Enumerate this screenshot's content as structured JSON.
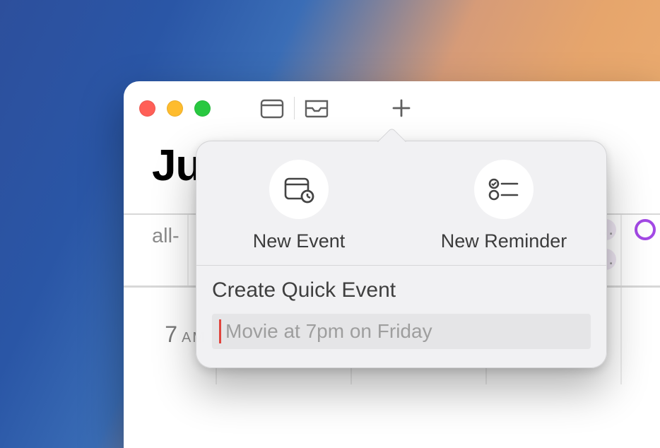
{
  "toolbar": {
    "icons": {
      "calendar": "calendar-icon",
      "inbox": "tray-icon",
      "add": "plus-icon"
    }
  },
  "header": {
    "month_abbrev": "Ju"
  },
  "calendar": {
    "allday_label": "all-",
    "hour": {
      "value": "7",
      "period": "AM"
    },
    "chips": {
      "more1": "…",
      "more2": "…"
    }
  },
  "popover": {
    "option1": {
      "label": "New Event"
    },
    "option2": {
      "label": "New Reminder"
    },
    "quick_title": "Create Quick Event",
    "quick_placeholder": "Movie at 7pm on Friday",
    "quick_value": ""
  }
}
